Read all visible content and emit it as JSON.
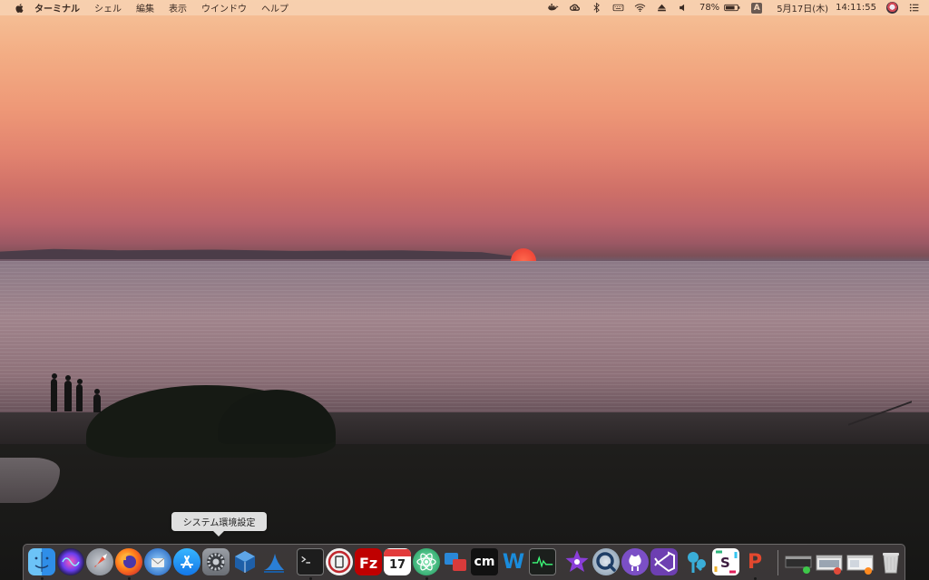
{
  "menubar": {
    "app_name": "ターミナル",
    "menus": [
      "シェル",
      "編集",
      "表示",
      "ウインドウ",
      "ヘルプ"
    ],
    "battery_percent": "78%",
    "input_source": "A",
    "date": "5月17日(木)",
    "time": "14:11:55",
    "status_icons": [
      "docker-icon",
      "creative-cloud-icon",
      "bluetooth-icon",
      "keyboard-icon",
      "wifi-icon",
      "eject-icon",
      "volume-icon",
      "battery-icon",
      "input-source-icon",
      "user-avatar",
      "notification-list-icon"
    ]
  },
  "tooltip": {
    "text": "システム環境設定"
  },
  "dock": {
    "items": [
      {
        "name": "finder",
        "running": true
      },
      {
        "name": "siri",
        "running": false
      },
      {
        "name": "launchpad",
        "running": false
      },
      {
        "name": "firefox",
        "running": true
      },
      {
        "name": "thunderbird",
        "running": false
      },
      {
        "name": "app-store",
        "running": false
      },
      {
        "name": "system-preferences",
        "running": false
      },
      {
        "name": "virtualbox",
        "running": false
      },
      {
        "name": "wireshark",
        "running": false
      },
      {
        "name": "terminal",
        "running": true
      },
      {
        "name": "vpn-client",
        "running": false
      },
      {
        "name": "filezilla",
        "running": false
      },
      {
        "name": "calendar",
        "running": false,
        "day": "17"
      },
      {
        "name": "atom",
        "running": true
      },
      {
        "name": "teamviewer",
        "running": false
      },
      {
        "name": "cm-app",
        "running": false,
        "label": "cm"
      },
      {
        "name": "word-editor",
        "running": false,
        "label": "W"
      },
      {
        "name": "activity-monitor",
        "running": false
      },
      {
        "name": "imovie",
        "running": false
      },
      {
        "name": "quicktime",
        "running": false
      },
      {
        "name": "github-desktop",
        "running": false
      },
      {
        "name": "visual-studio",
        "running": false
      },
      {
        "name": "sourcetree",
        "running": false
      },
      {
        "name": "slack",
        "running": false
      },
      {
        "name": "powerpoint",
        "running": false,
        "label": "P"
      },
      {
        "name": "minimized-window-1",
        "running": false
      },
      {
        "name": "minimized-window-2",
        "running": false
      },
      {
        "name": "minimized-window-3",
        "running": false
      },
      {
        "name": "trash",
        "running": false
      }
    ]
  }
}
